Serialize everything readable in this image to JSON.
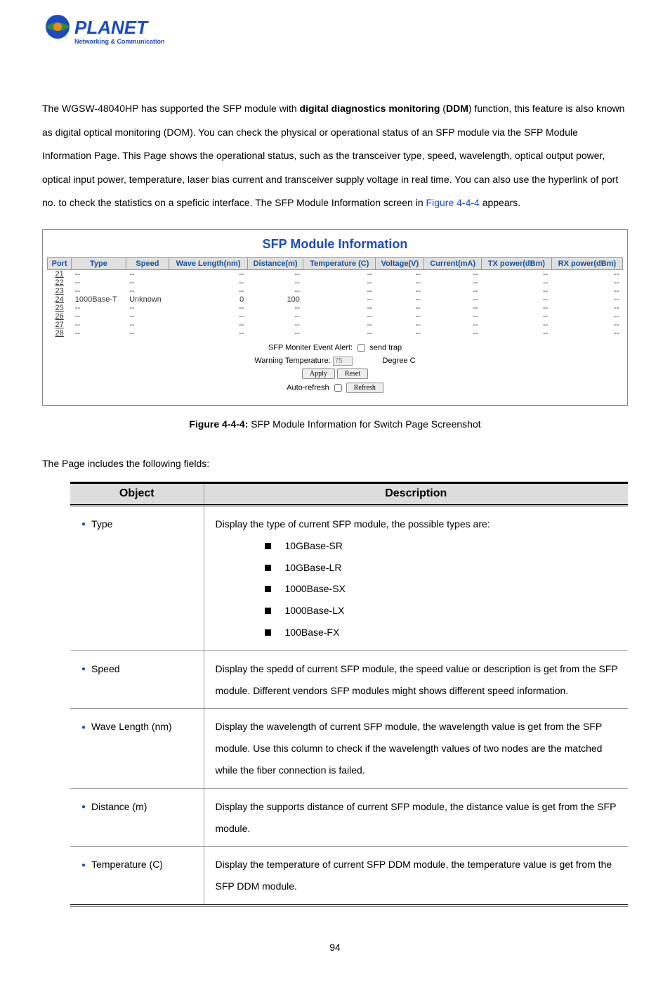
{
  "logo": {
    "brand": "PLANET",
    "tagline": "Networking & Communication"
  },
  "intro": {
    "text_part1": "The WGSW-48040HP has supported the SFP module with ",
    "bold_part1": "digital diagnostics monitoring",
    "text_part2": " (",
    "bold_part2": "DDM",
    "text_part3": ") function, this feature is also known as digital optical monitoring (DOM). You can check the physical or operational status of an SFP module via the SFP Module Information Page. This Page shows the operational status, such as the transceiver type, speed, wavelength, optical output power, optical input power, temperature, laser bias current and transceiver supply voltage in real time. You can also use the hyperlink of port no. to check the statistics on a speficic interface. The SFP Module Information screen in ",
    "figure_link": "Figure 4-4-4",
    "text_part4": " appears."
  },
  "figure": {
    "title": "SFP Module Information",
    "headers": [
      "Port",
      "Type",
      "Speed",
      "Wave Length(nm)",
      "Distance(m)",
      "Temperature (C)",
      "Voltage(V)",
      "Current(mA)",
      "TX power(dBm)",
      "RX power(dBm)"
    ],
    "rows": [
      {
        "port": "21",
        "type": "--",
        "speed": "--",
        "wl": "--",
        "dist": "--",
        "temp": "--",
        "volt": "--",
        "curr": "--",
        "tx": "--",
        "rx": "--"
      },
      {
        "port": "22",
        "type": "--",
        "speed": "--",
        "wl": "--",
        "dist": "--",
        "temp": "--",
        "volt": "--",
        "curr": "--",
        "tx": "--",
        "rx": "--"
      },
      {
        "port": "23",
        "type": "--",
        "speed": "--",
        "wl": "--",
        "dist": "--",
        "temp": "--",
        "volt": "--",
        "curr": "--",
        "tx": "--",
        "rx": "--"
      },
      {
        "port": "24",
        "type": "1000Base-T",
        "speed": "Unknown",
        "wl": "0",
        "dist": "100",
        "temp": "--",
        "volt": "--",
        "curr": "--",
        "tx": "--",
        "rx": "--"
      },
      {
        "port": "25",
        "type": "--",
        "speed": "--",
        "wl": "--",
        "dist": "--",
        "temp": "--",
        "volt": "--",
        "curr": "--",
        "tx": "--",
        "rx": "--"
      },
      {
        "port": "26",
        "type": "--",
        "speed": "--",
        "wl": "--",
        "dist": "--",
        "temp": "--",
        "volt": "--",
        "curr": "--",
        "tx": "--",
        "rx": "--"
      },
      {
        "port": "27",
        "type": "--",
        "speed": "--",
        "wl": "--",
        "dist": "--",
        "temp": "--",
        "volt": "--",
        "curr": "--",
        "tx": "--",
        "rx": "--"
      },
      {
        "port": "28",
        "type": "--",
        "speed": "--",
        "wl": "--",
        "dist": "--",
        "temp": "--",
        "volt": "--",
        "curr": "--",
        "tx": "--",
        "rx": "--"
      }
    ],
    "monitor_label": "SFP Moniter Event Alert:",
    "send_trap_label": "send trap",
    "warning_temp_label": "Warning Temperature:",
    "warning_temp_value": "75",
    "degree_label": "Degree C",
    "apply_btn": "Apply",
    "reset_btn": "Reset",
    "auto_refresh_label": "Auto-refresh",
    "refresh_btn": "Refresh"
  },
  "caption": {
    "prefix": "Figure 4-4-4:",
    "text": " SFP Module Information for Switch Page Screenshot"
  },
  "fields_intro": "The Page includes the following fields:",
  "fields_header": {
    "object": "Object",
    "description": "Description"
  },
  "fields": [
    {
      "object": "Type",
      "desc_lead": "Display the type of current SFP module, the possible types are:",
      "sub": [
        "10GBase-SR",
        "10GBase-LR",
        "1000Base-SX",
        "1000Base-LX",
        "100Base-FX"
      ]
    },
    {
      "object": "Speed",
      "desc": "Display the spedd of current SFP module, the speed value or description is get from the SFP module. Different vendors SFP modules might shows different speed information."
    },
    {
      "object": "Wave Length (nm)",
      "desc": "Display the wavelength of current SFP module, the wavelength value is get from the SFP module. Use this column to check if the wavelength values of two nodes are the matched while the fiber connection is failed."
    },
    {
      "object": "Distance (m)",
      "desc": "Display the supports distance of current SFP module, the distance value is get from the SFP module."
    },
    {
      "object": "Temperature (C)",
      "desc": "Display the temperature of current SFP DDM module, the temperature value is get from the SFP DDM module."
    }
  ],
  "page_number": "94"
}
